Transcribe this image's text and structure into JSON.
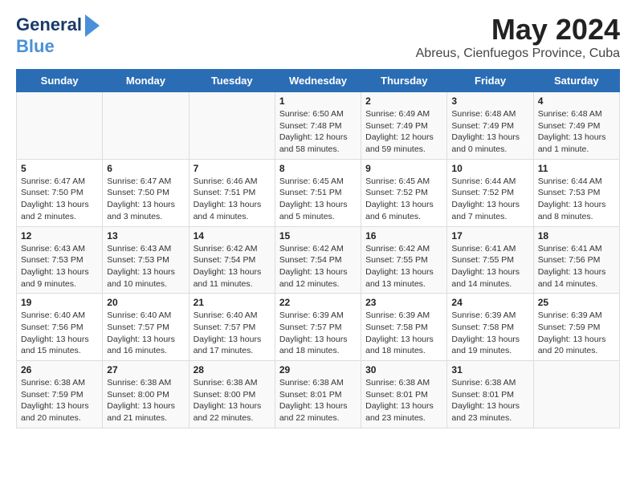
{
  "logo": {
    "line1": "General",
    "line2": "Blue"
  },
  "title": "May 2024",
  "subtitle": "Abreus, Cienfuegos Province, Cuba",
  "days_of_week": [
    "Sunday",
    "Monday",
    "Tuesday",
    "Wednesday",
    "Thursday",
    "Friday",
    "Saturday"
  ],
  "weeks": [
    [
      {
        "day": "",
        "content": ""
      },
      {
        "day": "",
        "content": ""
      },
      {
        "day": "",
        "content": ""
      },
      {
        "day": "1",
        "content": "Sunrise: 6:50 AM\nSunset: 7:48 PM\nDaylight: 12 hours and 58 minutes."
      },
      {
        "day": "2",
        "content": "Sunrise: 6:49 AM\nSunset: 7:49 PM\nDaylight: 12 hours and 59 minutes."
      },
      {
        "day": "3",
        "content": "Sunrise: 6:48 AM\nSunset: 7:49 PM\nDaylight: 13 hours and 0 minutes."
      },
      {
        "day": "4",
        "content": "Sunrise: 6:48 AM\nSunset: 7:49 PM\nDaylight: 13 hours and 1 minute."
      }
    ],
    [
      {
        "day": "5",
        "content": "Sunrise: 6:47 AM\nSunset: 7:50 PM\nDaylight: 13 hours and 2 minutes."
      },
      {
        "day": "6",
        "content": "Sunrise: 6:47 AM\nSunset: 7:50 PM\nDaylight: 13 hours and 3 minutes."
      },
      {
        "day": "7",
        "content": "Sunrise: 6:46 AM\nSunset: 7:51 PM\nDaylight: 13 hours and 4 minutes."
      },
      {
        "day": "8",
        "content": "Sunrise: 6:45 AM\nSunset: 7:51 PM\nDaylight: 13 hours and 5 minutes."
      },
      {
        "day": "9",
        "content": "Sunrise: 6:45 AM\nSunset: 7:52 PM\nDaylight: 13 hours and 6 minutes."
      },
      {
        "day": "10",
        "content": "Sunrise: 6:44 AM\nSunset: 7:52 PM\nDaylight: 13 hours and 7 minutes."
      },
      {
        "day": "11",
        "content": "Sunrise: 6:44 AM\nSunset: 7:53 PM\nDaylight: 13 hours and 8 minutes."
      }
    ],
    [
      {
        "day": "12",
        "content": "Sunrise: 6:43 AM\nSunset: 7:53 PM\nDaylight: 13 hours and 9 minutes."
      },
      {
        "day": "13",
        "content": "Sunrise: 6:43 AM\nSunset: 7:53 PM\nDaylight: 13 hours and 10 minutes."
      },
      {
        "day": "14",
        "content": "Sunrise: 6:42 AM\nSunset: 7:54 PM\nDaylight: 13 hours and 11 minutes."
      },
      {
        "day": "15",
        "content": "Sunrise: 6:42 AM\nSunset: 7:54 PM\nDaylight: 13 hours and 12 minutes."
      },
      {
        "day": "16",
        "content": "Sunrise: 6:42 AM\nSunset: 7:55 PM\nDaylight: 13 hours and 13 minutes."
      },
      {
        "day": "17",
        "content": "Sunrise: 6:41 AM\nSunset: 7:55 PM\nDaylight: 13 hours and 14 minutes."
      },
      {
        "day": "18",
        "content": "Sunrise: 6:41 AM\nSunset: 7:56 PM\nDaylight: 13 hours and 14 minutes."
      }
    ],
    [
      {
        "day": "19",
        "content": "Sunrise: 6:40 AM\nSunset: 7:56 PM\nDaylight: 13 hours and 15 minutes."
      },
      {
        "day": "20",
        "content": "Sunrise: 6:40 AM\nSunset: 7:57 PM\nDaylight: 13 hours and 16 minutes."
      },
      {
        "day": "21",
        "content": "Sunrise: 6:40 AM\nSunset: 7:57 PM\nDaylight: 13 hours and 17 minutes."
      },
      {
        "day": "22",
        "content": "Sunrise: 6:39 AM\nSunset: 7:57 PM\nDaylight: 13 hours and 18 minutes."
      },
      {
        "day": "23",
        "content": "Sunrise: 6:39 AM\nSunset: 7:58 PM\nDaylight: 13 hours and 18 minutes."
      },
      {
        "day": "24",
        "content": "Sunrise: 6:39 AM\nSunset: 7:58 PM\nDaylight: 13 hours and 19 minutes."
      },
      {
        "day": "25",
        "content": "Sunrise: 6:39 AM\nSunset: 7:59 PM\nDaylight: 13 hours and 20 minutes."
      }
    ],
    [
      {
        "day": "26",
        "content": "Sunrise: 6:38 AM\nSunset: 7:59 PM\nDaylight: 13 hours and 20 minutes."
      },
      {
        "day": "27",
        "content": "Sunrise: 6:38 AM\nSunset: 8:00 PM\nDaylight: 13 hours and 21 minutes."
      },
      {
        "day": "28",
        "content": "Sunrise: 6:38 AM\nSunset: 8:00 PM\nDaylight: 13 hours and 22 minutes."
      },
      {
        "day": "29",
        "content": "Sunrise: 6:38 AM\nSunset: 8:01 PM\nDaylight: 13 hours and 22 minutes."
      },
      {
        "day": "30",
        "content": "Sunrise: 6:38 AM\nSunset: 8:01 PM\nDaylight: 13 hours and 23 minutes."
      },
      {
        "day": "31",
        "content": "Sunrise: 6:38 AM\nSunset: 8:01 PM\nDaylight: 13 hours and 23 minutes."
      },
      {
        "day": "",
        "content": ""
      }
    ]
  ]
}
